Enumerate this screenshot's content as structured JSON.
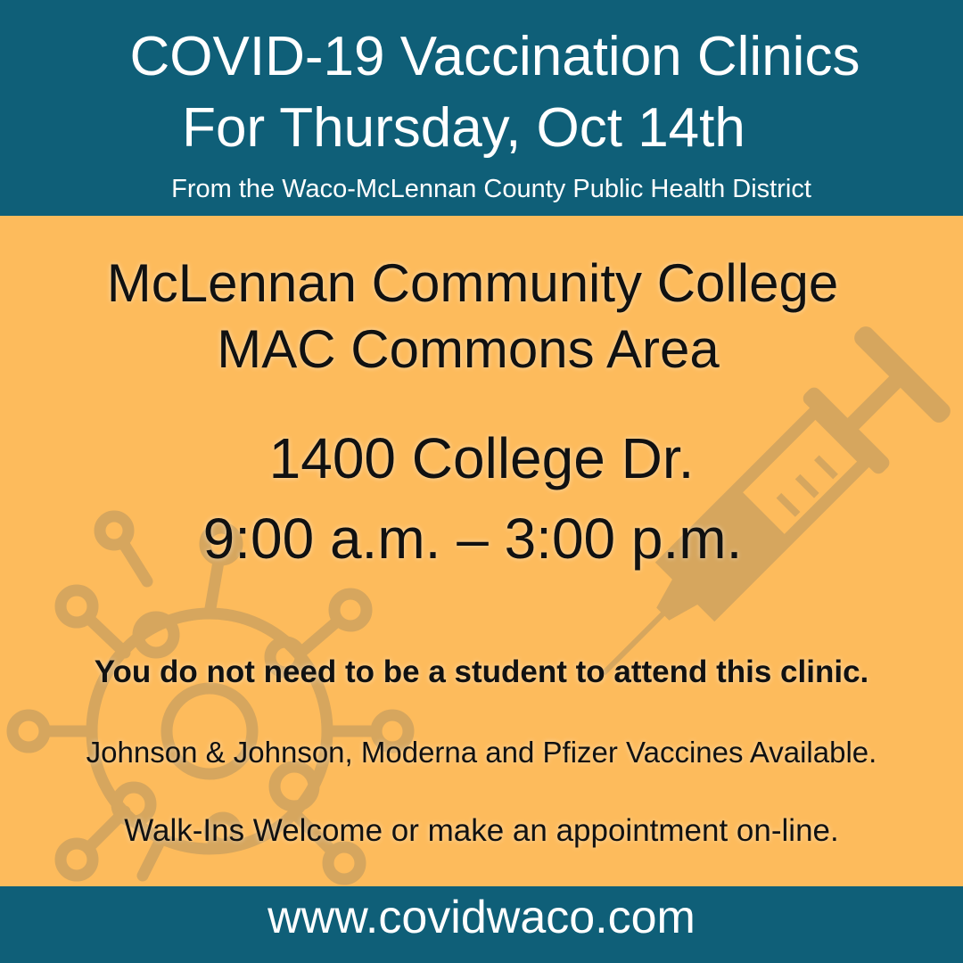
{
  "header": {
    "title_line1": "COVID-19 Vaccination Clinics",
    "title_line2": "For Thursday, Oct 14th",
    "subtitle": "From the Waco-McLennan County Public Health District"
  },
  "main": {
    "venue_line1": "McLennan Community College",
    "venue_line2": "MAC Commons Area",
    "address": "1400 College Dr.",
    "hours": "9:00 a.m. – 3:00 p.m.",
    "note": "You do not need to be a student to attend this clinic.",
    "vaccines": "Johnson & Johnson, Moderna and Pfizer Vaccines Available.",
    "walkin": "Walk-Ins Welcome or make an appointment on-line."
  },
  "footer": {
    "url": "www.covidwaco.com"
  },
  "icons": [
    "syringe-icon",
    "virus-icon"
  ],
  "colors": {
    "banner": "#0f5f78",
    "panel": "#fdbb5c",
    "illustration": "#d6a65e",
    "text_light": "#ffffff",
    "text_dark": "#111111"
  }
}
